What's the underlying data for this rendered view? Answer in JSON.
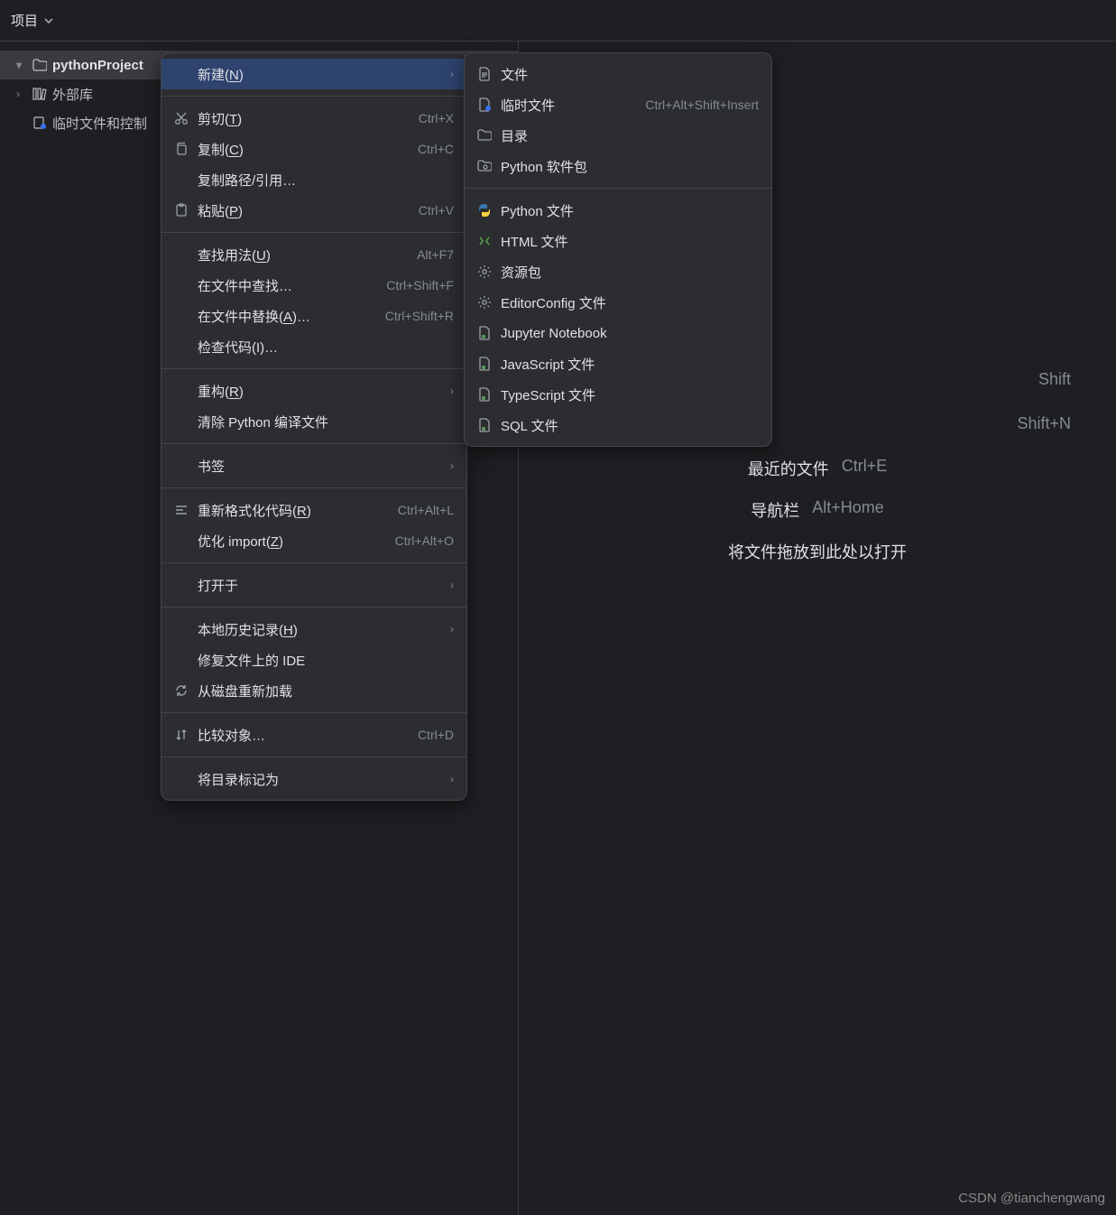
{
  "topbar": {
    "label": "项目"
  },
  "tree": {
    "project": "pythonProject",
    "external": "外部库",
    "scratch": "临时文件和控制"
  },
  "hints": {
    "recent_label": "最近的文件",
    "recent_sc": "Ctrl+E",
    "nav_label": "导航栏",
    "nav_sc": "Alt+Home",
    "drop_label": "将文件拖放到此处以打开",
    "shift_tail": "Shift",
    "shiftn_tail": "Shift+N"
  },
  "ctx": [
    {
      "label_pre": "新建(",
      "mn": "N",
      "label_post": ")",
      "highlight": true,
      "submenu": true,
      "icon": ""
    },
    {
      "sep": true
    },
    {
      "label_pre": "剪切(",
      "mn": "T",
      "label_post": ")",
      "shortcut": "Ctrl+X",
      "icon": "cut"
    },
    {
      "label_pre": "复制(",
      "mn": "C",
      "label_post": ")",
      "shortcut": "Ctrl+C",
      "icon": "copy"
    },
    {
      "label_pre": "复制路径/引用…",
      "mn": "",
      "label_post": "",
      "icon": ""
    },
    {
      "label_pre": "粘贴(",
      "mn": "P",
      "label_post": ")",
      "shortcut": "Ctrl+V",
      "icon": "paste"
    },
    {
      "sep": true
    },
    {
      "label_pre": "查找用法(",
      "mn": "U",
      "label_post": ")",
      "shortcut": "Alt+F7",
      "icon": ""
    },
    {
      "label_pre": "在文件中查找…",
      "mn": "",
      "label_post": "",
      "shortcut": "Ctrl+Shift+F",
      "icon": ""
    },
    {
      "label_pre": "在文件中替换(",
      "mn": "A",
      "label_post": ")…",
      "shortcut": "Ctrl+Shift+R",
      "icon": ""
    },
    {
      "label_pre": "检查代码(I)…",
      "mn": "",
      "label_post": "",
      "icon": ""
    },
    {
      "sep": true
    },
    {
      "label_pre": "重构(",
      "mn": "R",
      "label_post": ")",
      "submenu": true,
      "icon": ""
    },
    {
      "label_pre": "清除 Python 编译文件",
      "mn": "",
      "label_post": "",
      "icon": ""
    },
    {
      "sep": true
    },
    {
      "label_pre": "书签",
      "mn": "",
      "label_post": "",
      "submenu": true,
      "icon": ""
    },
    {
      "sep": true
    },
    {
      "label_pre": "重新格式化代码(",
      "mn": "R",
      "label_post": ")",
      "shortcut": "Ctrl+Alt+L",
      "icon": "reformat"
    },
    {
      "label_pre": "优化 import(",
      "mn": "Z",
      "label_post": ")",
      "shortcut": "Ctrl+Alt+O",
      "icon": ""
    },
    {
      "sep": true
    },
    {
      "label_pre": "打开于",
      "mn": "",
      "label_post": "",
      "submenu": true,
      "icon": ""
    },
    {
      "sep": true
    },
    {
      "label_pre": "本地历史记录(",
      "mn": "H",
      "label_post": ")",
      "submenu": true,
      "icon": ""
    },
    {
      "label_pre": "修复文件上的 IDE",
      "mn": "",
      "label_post": "",
      "icon": ""
    },
    {
      "label_pre": "从磁盘重新加载",
      "mn": "",
      "label_post": "",
      "icon": "reload"
    },
    {
      "sep": true
    },
    {
      "label_pre": "比较对象…",
      "mn": "",
      "label_post": "",
      "shortcut": "Ctrl+D",
      "icon": "compare"
    },
    {
      "sep": true
    },
    {
      "label_pre": "将目录标记为",
      "mn": "",
      "label_post": "",
      "submenu": true,
      "icon": ""
    }
  ],
  "submenu": [
    {
      "label": "文件",
      "icon": "file"
    },
    {
      "label": "临时文件",
      "shortcut": "Ctrl+Alt+Shift+Insert",
      "icon": "scratch-file"
    },
    {
      "label": "目录",
      "icon": "folder"
    },
    {
      "label": "Python 软件包",
      "icon": "package"
    },
    {
      "sep": true
    },
    {
      "label": "Python 文件",
      "icon": "python"
    },
    {
      "label": "HTML 文件",
      "icon": "html"
    },
    {
      "label": "资源包",
      "icon": "gear"
    },
    {
      "label": "EditorConfig 文件",
      "icon": "gear"
    },
    {
      "label": "Jupyter Notebook",
      "icon": "jupyter"
    },
    {
      "label": "JavaScript 文件",
      "icon": "js"
    },
    {
      "label": "TypeScript 文件",
      "icon": "ts"
    },
    {
      "label": "SQL 文件",
      "icon": "sql"
    }
  ],
  "watermark": "CSDN @tianchengwang"
}
